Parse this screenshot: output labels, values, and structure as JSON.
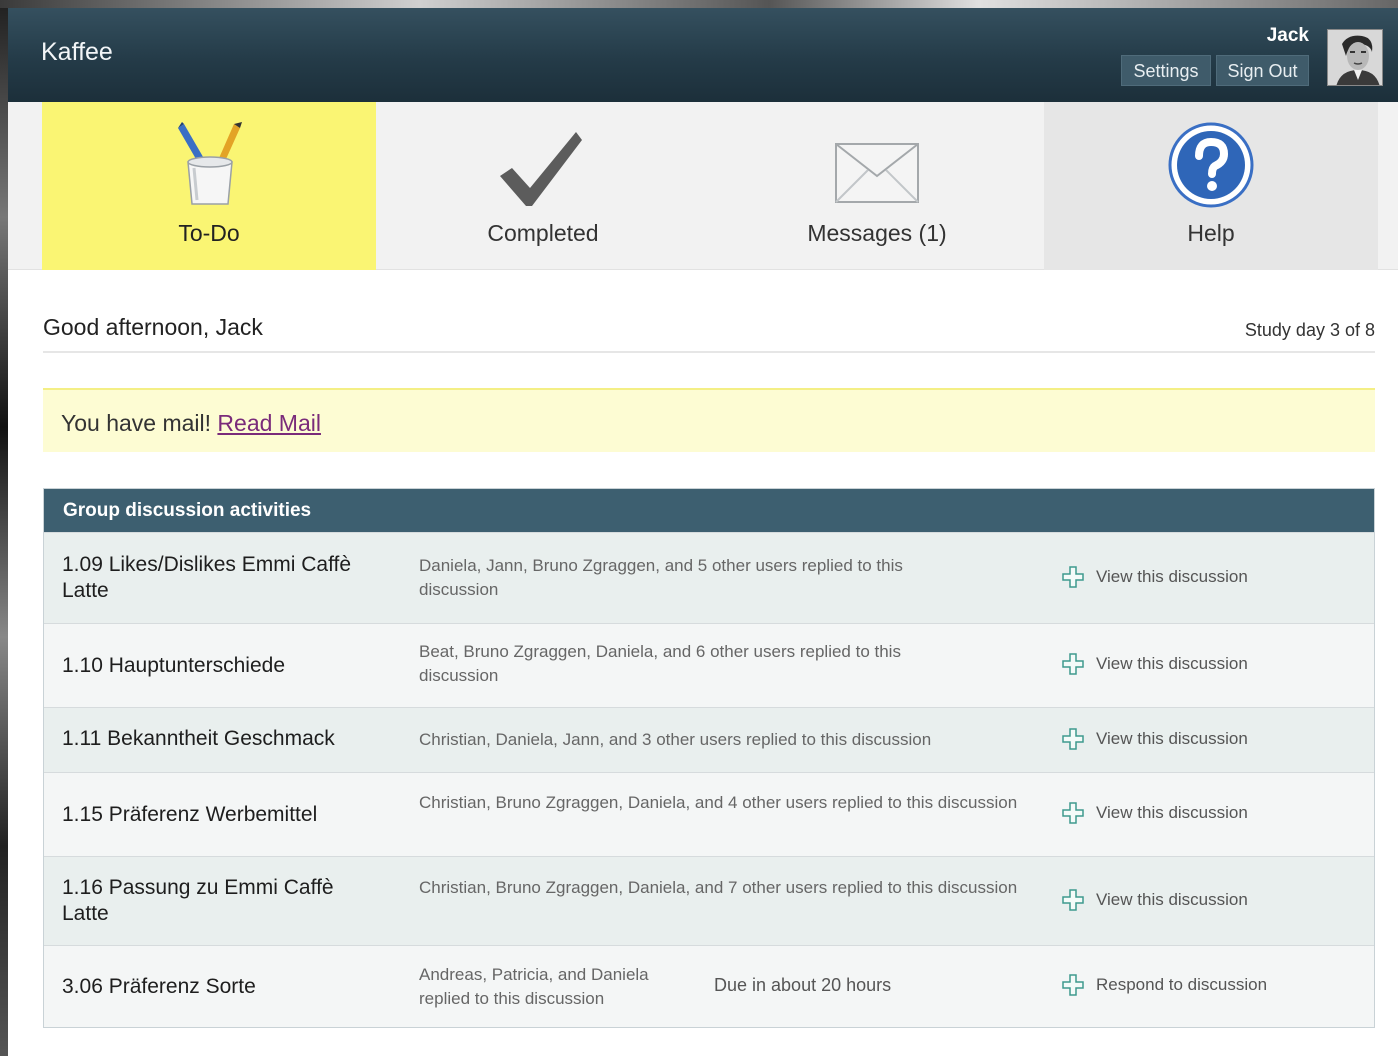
{
  "app": {
    "title": "Kaffee"
  },
  "user": {
    "name": "Jack",
    "settings_label": "Settings",
    "signout_label": "Sign Out"
  },
  "nav": {
    "tabs": [
      {
        "label": "To-Do",
        "icon": "pencil-cup-icon",
        "active": true
      },
      {
        "label": "Completed",
        "icon": "checkmark-icon",
        "active": false
      },
      {
        "label": "Messages (1)",
        "icon": "envelope-icon",
        "active": false
      },
      {
        "label": "Help",
        "icon": "help-question-icon",
        "active": false
      }
    ]
  },
  "greeting": {
    "text": "Good afternoon, Jack",
    "study_day": "Study day 3 of 8"
  },
  "mail_banner": {
    "text": "You have mail!",
    "link": "Read Mail"
  },
  "discussions": {
    "heading": "Group discussion activities",
    "rows": [
      {
        "title": "1.09 Likes/Dislikes Emmi Caffè Latte",
        "info": "Daniela, Jann, Bruno Zgraggen, and 5 other users replied to this discussion",
        "due": "",
        "action": "View this discussion"
      },
      {
        "title": "1.10 Hauptunterschiede",
        "info": "Beat, Bruno Zgraggen, Daniela, and 6 other users replied to this discussion",
        "due": "",
        "action": "View this discussion"
      },
      {
        "title": "1.11 Bekanntheit Geschmack",
        "info": "Christian, Daniela, Jann, and 3 other users replied to this discussion",
        "due": "",
        "action": "View this discussion"
      },
      {
        "title": "1.15 Präferenz Werbemittel",
        "info": "Christian, Bruno Zgraggen, Daniela, and 4 other users replied to this discussion",
        "due": "",
        "action": "View this discussion"
      },
      {
        "title": "1.16 Passung zu Emmi Caffè Latte",
        "info": "Christian, Bruno Zgraggen, Daniela, and 7 other users replied to this discussion",
        "due": "",
        "action": "View this discussion"
      },
      {
        "title": "3.06 Präferenz Sorte",
        "info": "Andreas, Patricia, and Daniela replied to this discussion",
        "due": "Due in about 20 hours",
        "action": "Respond to discussion"
      }
    ]
  },
  "colors": {
    "header": "#243b48",
    "active_tab": "#faf573",
    "table_head": "#3d5f70",
    "banner": "#fdfcd3"
  }
}
